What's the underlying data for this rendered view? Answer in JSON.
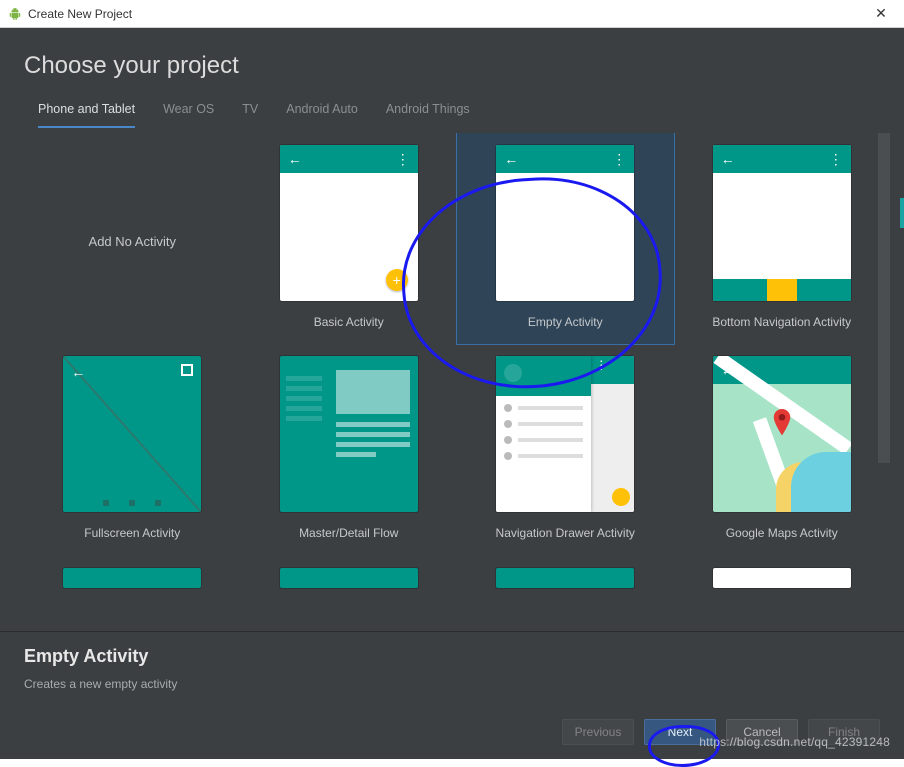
{
  "window": {
    "title": "Create New Project"
  },
  "page": {
    "heading": "Choose your project"
  },
  "tabs": [
    {
      "label": "Phone and Tablet",
      "active": true
    },
    {
      "label": "Wear OS",
      "active": false
    },
    {
      "label": "TV",
      "active": false
    },
    {
      "label": "Android Auto",
      "active": false
    },
    {
      "label": "Android Things",
      "active": false
    }
  ],
  "templates": {
    "row1": [
      {
        "label": "Add No Activity",
        "type": "none"
      },
      {
        "label": "Basic Activity",
        "type": "basic"
      },
      {
        "label": "Empty Activity",
        "type": "empty",
        "selected": true
      },
      {
        "label": "Bottom Navigation Activity",
        "type": "bottomnav"
      }
    ],
    "row2": [
      {
        "label": "Fullscreen Activity",
        "type": "fullscreen"
      },
      {
        "label": "Master/Detail Flow",
        "type": "master"
      },
      {
        "label": "Navigation Drawer Activity",
        "type": "navdrawer"
      },
      {
        "label": "Google Maps Activity",
        "type": "maps"
      }
    ]
  },
  "selection": {
    "title": "Empty Activity",
    "description": "Creates a new empty activity"
  },
  "buttons": {
    "previous": "Previous",
    "next": "Next",
    "cancel": "Cancel",
    "finish": "Finish"
  },
  "watermark": "https://blog.csdn.net/qq_42391248",
  "colors": {
    "accent_teal": "#009688",
    "accent_amber": "#ffc107",
    "selection": "#2f4457",
    "tab_underline": "#4a88c7"
  }
}
